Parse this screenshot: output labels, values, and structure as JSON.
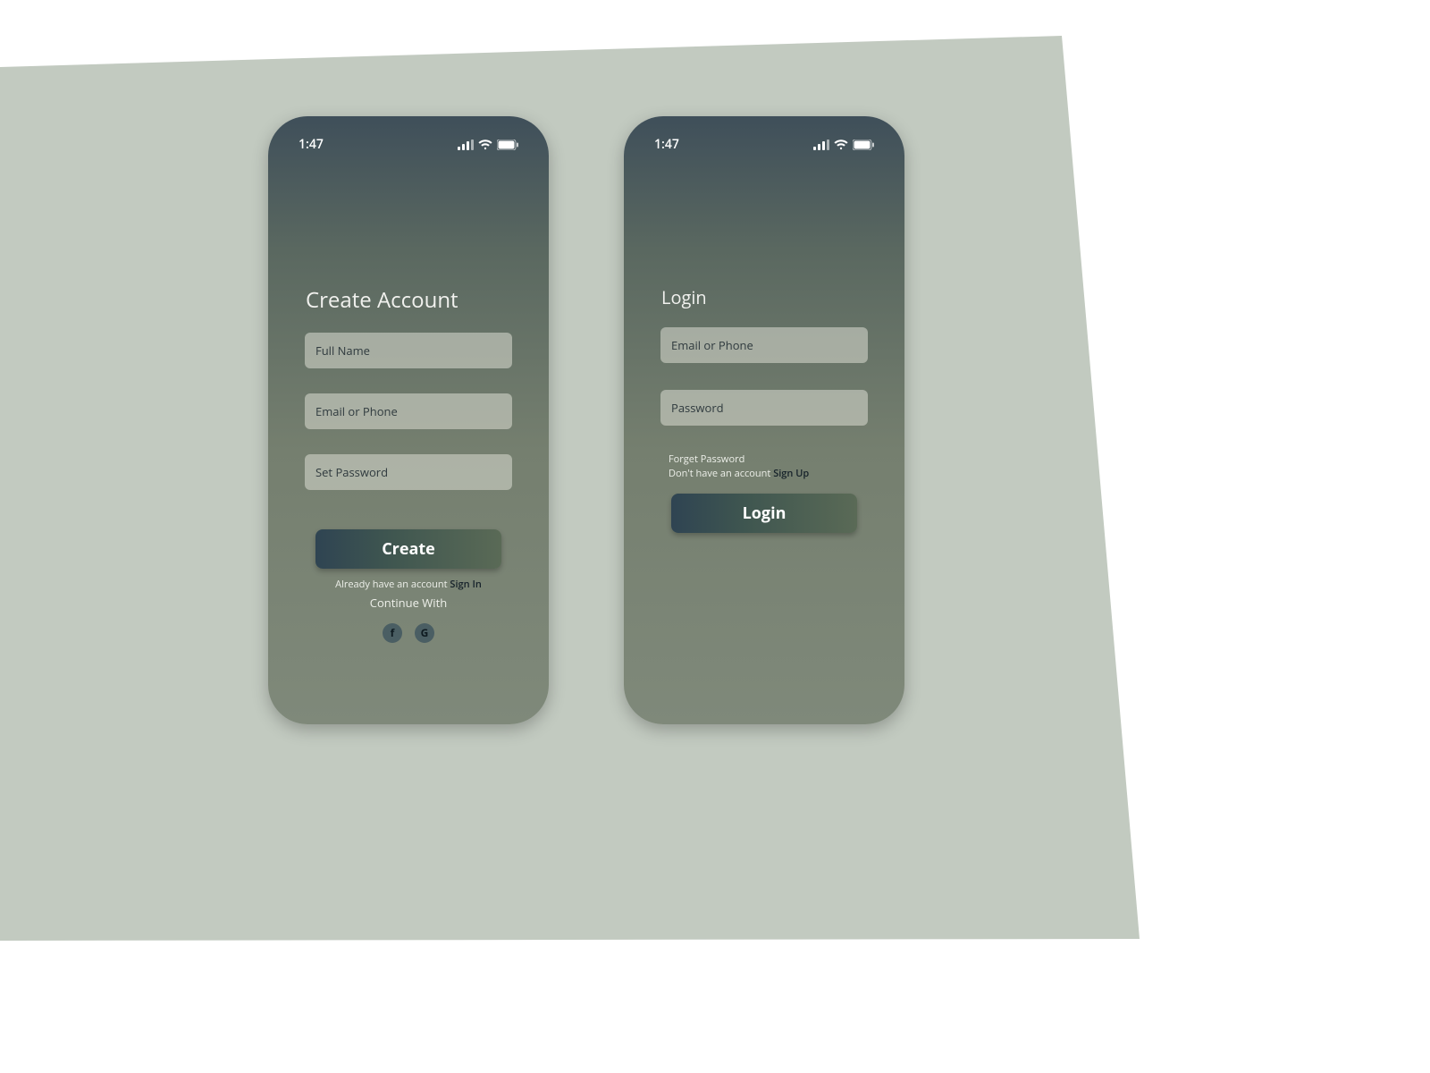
{
  "status": {
    "time": "1:47"
  },
  "create": {
    "title": "Create Account",
    "fields": {
      "full_name": "Full Name",
      "email_or_phone": "Email or Phone",
      "set_password": "Set Password"
    },
    "button": "Create",
    "already_prefix": "Already have an account ",
    "signin": "Sign In",
    "continue_with": "Continue With",
    "social": {
      "facebook": "f",
      "google": "G"
    }
  },
  "login": {
    "title": "Login",
    "fields": {
      "email_or_phone": "Email or Phone",
      "password": "Password"
    },
    "forget_password": "Forget Password",
    "no_account_prefix": "Don't have an account ",
    "signup": "Sign Up",
    "button": "Login"
  },
  "colors": {
    "sage": "#c2cac0",
    "gradient_top": "#3f4f5a",
    "gradient_bottom": "#7f897a",
    "accent_dark": "#16222a"
  }
}
